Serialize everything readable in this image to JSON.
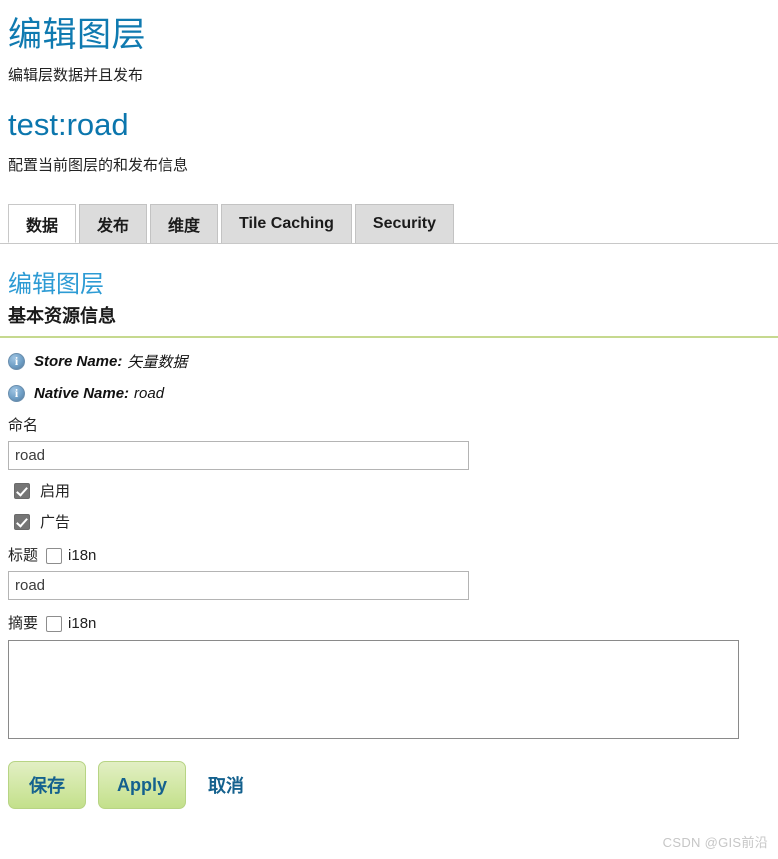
{
  "header": {
    "title": "编辑图层",
    "subtitle": "编辑层数据并且发布",
    "resource_title": "test:road",
    "resource_subtitle": "配置当前图层的和发布信息"
  },
  "tabs": [
    {
      "label": "数据",
      "active": true
    },
    {
      "label": "发布",
      "active": false
    },
    {
      "label": "维度",
      "active": false
    },
    {
      "label": "Tile Caching",
      "active": false
    },
    {
      "label": "Security",
      "active": false
    }
  ],
  "section": {
    "title": "编辑图层",
    "subtitle": "基本资源信息"
  },
  "info": [
    {
      "icon": "info-icon",
      "glyph": "i",
      "label": "Store Name:",
      "value": "矢量数据"
    },
    {
      "icon": "info-icon",
      "glyph": "i",
      "label": "Native Name:",
      "value": "road"
    }
  ],
  "form": {
    "name_label": "命名",
    "name_value": "road",
    "name_placeholder": "",
    "enabled_label": "启用",
    "enabled_checked": true,
    "advertised_label": "广告",
    "advertised_checked": true,
    "title_label": "标题",
    "title_i18n_label": "i18n",
    "title_i18n_checked": false,
    "title_value": "road",
    "title_placeholder": "",
    "abstract_label": "摘要",
    "abstract_i18n_label": "i18n",
    "abstract_i18n_checked": false,
    "abstract_value": "",
    "abstract_placeholder": ""
  },
  "footer": {
    "save_label": "保存",
    "apply_label": "Apply",
    "cancel_label": "取消"
  },
  "watermark": "CSDN @GIS前沿",
  "colors": {
    "heading_blue": "#0f7ab0",
    "resource_blue": "#0b76ad",
    "section_blue": "#2d9bd4",
    "rule_green": "#c6d98f",
    "button_green": "#c3e08b",
    "button_text_blue": "#14618e"
  }
}
